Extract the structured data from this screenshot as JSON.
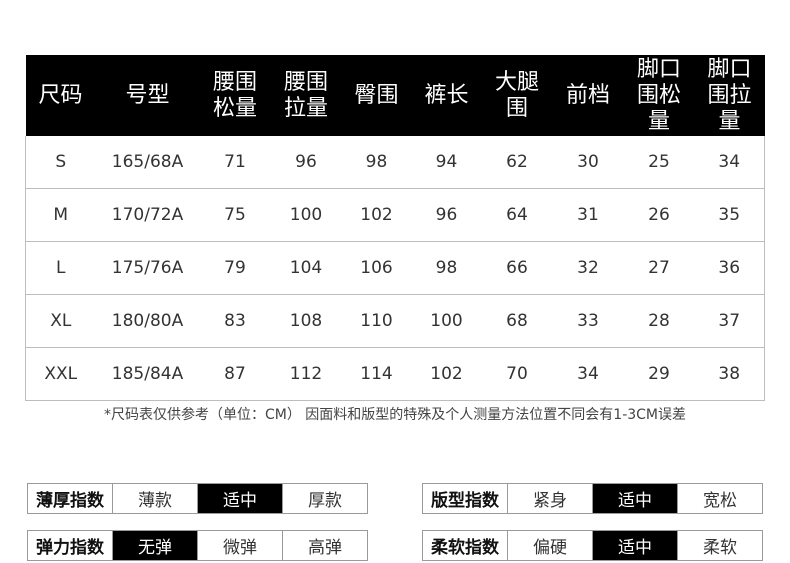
{
  "table": {
    "headers": [
      [
        "尺码"
      ],
      [
        "号型"
      ],
      [
        "腰围",
        "松量"
      ],
      [
        "腰围",
        "拉量"
      ],
      [
        "臀围"
      ],
      [
        "裤长"
      ],
      [
        "大腿",
        "围"
      ],
      [
        "前档"
      ],
      [
        "脚口",
        "围松",
        "量"
      ],
      [
        "脚口",
        "围拉",
        "量"
      ]
    ],
    "rows": [
      [
        "S",
        "165/68A",
        "71",
        "96",
        "98",
        "94",
        "62",
        "30",
        "25",
        "34"
      ],
      [
        "M",
        "170/72A",
        "75",
        "100",
        "102",
        "96",
        "64",
        "31",
        "26",
        "35"
      ],
      [
        "L",
        "175/76A",
        "79",
        "104",
        "106",
        "98",
        "66",
        "32",
        "27",
        "36"
      ],
      [
        "XL",
        "180/80A",
        "83",
        "108",
        "110",
        "100",
        "68",
        "33",
        "28",
        "37"
      ],
      [
        "XXL",
        "185/84A",
        "87",
        "112",
        "114",
        "102",
        "70",
        "34",
        "29",
        "38"
      ]
    ]
  },
  "note": "*尺码表仅供参考（单位：CM） 因面料和版型的特殊及个人测量方法位置不同会有1-3CM误差",
  "indices": {
    "thickness": {
      "label": "薄厚指数",
      "options": [
        "薄款",
        "适中",
        "厚款"
      ],
      "selected": "适中"
    },
    "fit": {
      "label": "版型指数",
      "options": [
        "紧身",
        "适中",
        "宽松"
      ],
      "selected": "适中"
    },
    "elasticity": {
      "label": "弹力指数",
      "options": [
        "无弹",
        "微弹",
        "高弹"
      ],
      "selected": "无弹"
    },
    "softness": {
      "label": "柔软指数",
      "options": [
        "偏硬",
        "适中",
        "柔软"
      ],
      "selected": "适中"
    }
  }
}
